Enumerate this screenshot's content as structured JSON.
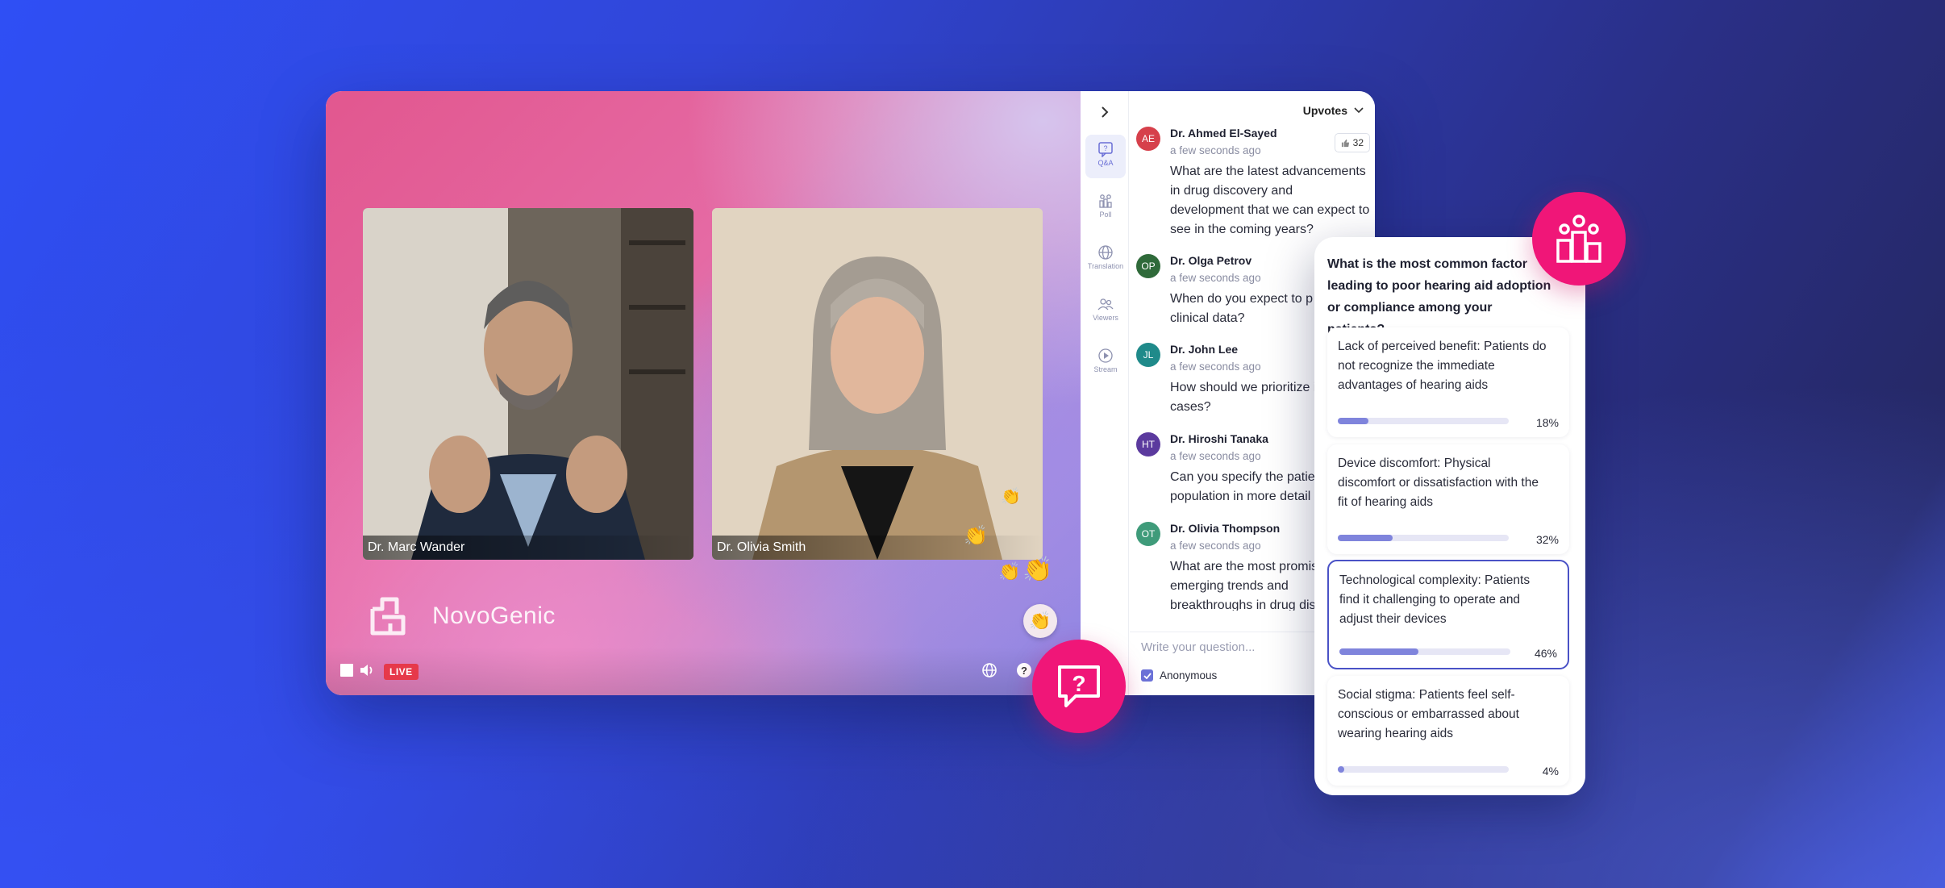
{
  "stage": {
    "participants": [
      {
        "name": "Dr. Marc Wander"
      },
      {
        "name": "Dr. Olivia Smith"
      }
    ],
    "brand": "NovoGenic",
    "live_label": "LIVE"
  },
  "rail": {
    "items": [
      {
        "label": "Q&A",
        "icon": "qa-icon",
        "active": true
      },
      {
        "label": "Poll",
        "icon": "poll-icon"
      },
      {
        "label": "Translation",
        "icon": "globe-icon"
      },
      {
        "label": "Viewers",
        "icon": "viewers-icon"
      },
      {
        "label": "Stream",
        "icon": "play-icon"
      }
    ]
  },
  "qa": {
    "sort_label": "Upvotes",
    "items": [
      {
        "initials": "AE",
        "author": "Dr. Ahmed El-Sayed",
        "time": "a few seconds ago",
        "text": "What are the latest advancements in drug discovery and development that we can expect to see in the coming years?",
        "upvotes": "32",
        "color": "#d6404b"
      },
      {
        "initials": "OP",
        "author": "Dr. Olga Petrov",
        "time": "a few seconds ago",
        "text": "When do you expect to p your clinical data?",
        "color": "#2f6a3a"
      },
      {
        "initials": "JL",
        "author": "Dr. John Lee",
        "time": "a few seconds ago",
        "text": "How should we prioritize in severe cases?",
        "color": "#1f8a8a"
      },
      {
        "initials": "HT",
        "author": "Dr. Hiroshi Tanaka",
        "time": "a few seconds ago",
        "text": "Can you specify the patie population in more detail",
        "color": "#5b3a9e"
      },
      {
        "initials": "OT",
        "author": "Dr. Olivia Thompson",
        "time": "a few seconds ago",
        "text": "What are the most promis emerging trends and breakthroughs in drug dis and development for the",
        "color": "#3f9b7a"
      }
    ],
    "input_placeholder": "Write your question...",
    "anonymous_label": "Anonymous"
  },
  "poll": {
    "question": "What is the most common factor leading to poor hearing aid adoption or compliance among your patients?",
    "options": [
      {
        "text": "Lack of perceived benefit: Patients do not recognize the immediate advantages of hearing aids",
        "percent": "18%",
        "value": 18
      },
      {
        "text": "Device discomfort: Physical discomfort or dissatisfaction with the fit of hearing aids",
        "percent": "32%",
        "value": 32
      },
      {
        "text": "Technological complexity: Patients find it challenging to operate and adjust their devices",
        "percent": "46%",
        "value": 46,
        "selected": true
      },
      {
        "text": "Social stigma: Patients feel self-conscious or embarrassed about wearing hearing aids",
        "percent": "4%",
        "value": 4
      }
    ]
  },
  "colors": {
    "accent": "#f01678",
    "primary": "#6b72d8",
    "live": "#e6394a"
  }
}
